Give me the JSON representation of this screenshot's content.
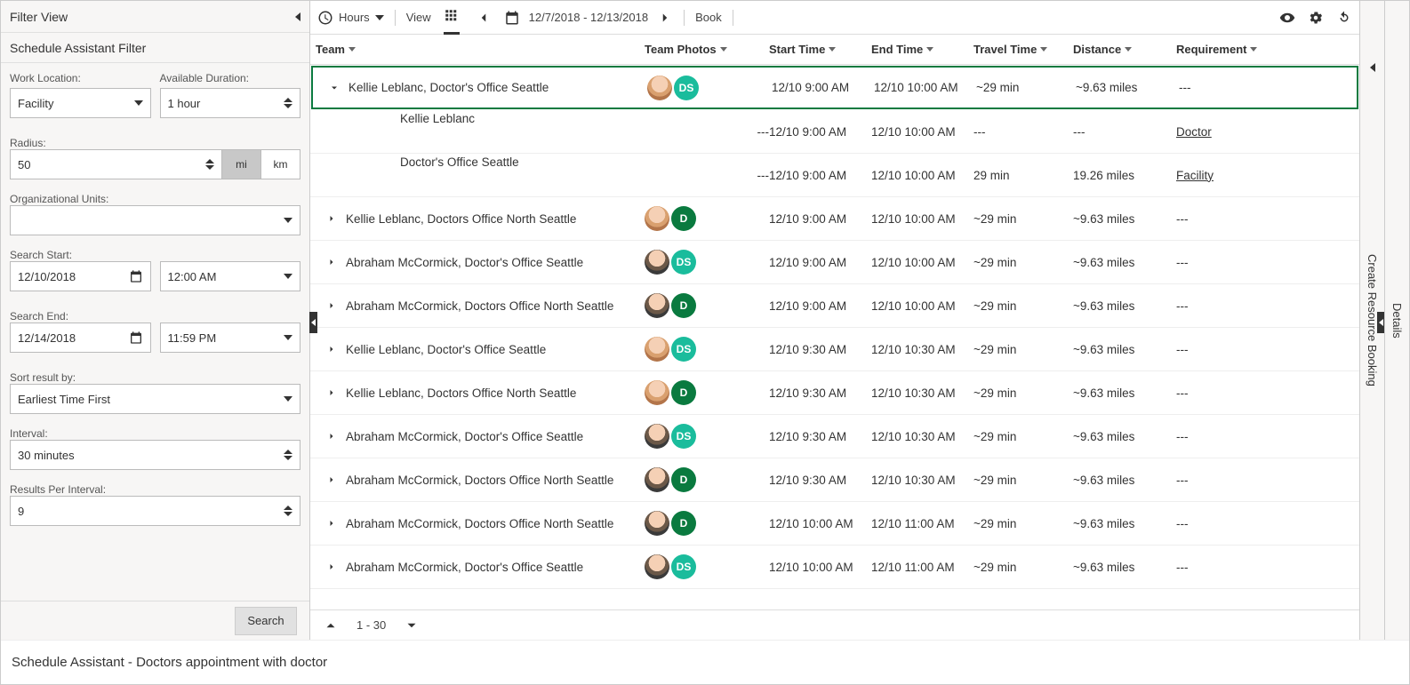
{
  "footer_title": "Schedule Assistant - Doctors appointment with doctor",
  "filter": {
    "panel_title": "Filter View",
    "sub_title": "Schedule Assistant Filter",
    "work_location_label": "Work Location:",
    "work_location_value": "Facility",
    "available_duration_label": "Available Duration:",
    "available_duration_value": "1 hour",
    "radius_label": "Radius:",
    "radius_value": "50",
    "unit_mi": "mi",
    "unit_km": "km",
    "org_units_label": "Organizational Units:",
    "org_units_value": "",
    "search_start_label": "Search Start:",
    "search_start_date": "12/10/2018",
    "search_start_time": "12:00 AM",
    "search_end_label": "Search End:",
    "search_end_date": "12/14/2018",
    "search_end_time": "11:59 PM",
    "sort_label": "Sort result by:",
    "sort_value": "Earliest Time First",
    "interval_label": "Interval:",
    "interval_value": "30 minutes",
    "results_per_label": "Results Per Interval:",
    "results_per_value": "9",
    "search_button": "Search"
  },
  "toolbar": {
    "hours": "Hours",
    "view": "View",
    "date_range": "12/7/2018 - 12/13/2018",
    "book": "Book"
  },
  "columns": {
    "team": "Team",
    "photos": "Team Photos",
    "start": "Start Time",
    "end": "End Time",
    "travel": "Travel Time",
    "distance": "Distance",
    "requirement": "Requirement"
  },
  "rows": [
    {
      "expanded": true,
      "selected": true,
      "team": "Kellie Leblanc, Doctor's Office Seattle",
      "photos": [
        "f",
        "DS"
      ],
      "start": "12/10 9:00 AM",
      "end": "12/10 10:00 AM",
      "travel": "~29 min",
      "dist": "~9.63 miles",
      "req": "---"
    },
    {
      "indent": true,
      "team": "Kellie Leblanc",
      "photos": [
        "f_big"
      ],
      "photo_text": "---",
      "start": "12/10 9:00 AM",
      "end": "12/10 10:00 AM",
      "travel": "---",
      "dist": "---",
      "req": "Doctor",
      "req_link": true
    },
    {
      "indent": true,
      "team": "Doctor's Office Seattle",
      "photos": [
        "g_big"
      ],
      "photo_text": "---",
      "start": "12/10 9:00 AM",
      "end": "12/10 10:00 AM",
      "travel": "29 min",
      "dist": "19.26 miles",
      "req": "Facility",
      "req_link": true
    },
    {
      "team": "Kellie Leblanc, Doctors Office North Seattle",
      "photos": [
        "f",
        "D"
      ],
      "start": "12/10 9:00 AM",
      "end": "12/10 10:00 AM",
      "travel": "~29 min",
      "dist": "~9.63 miles",
      "req": "---"
    },
    {
      "team": "Abraham McCormick, Doctor's Office Seattle",
      "photos": [
        "m",
        "DS"
      ],
      "start": "12/10 9:00 AM",
      "end": "12/10 10:00 AM",
      "travel": "~29 min",
      "dist": "~9.63 miles",
      "req": "---"
    },
    {
      "team": "Abraham McCormick, Doctors Office North Seattle",
      "photos": [
        "m",
        "D"
      ],
      "start": "12/10 9:00 AM",
      "end": "12/10 10:00 AM",
      "travel": "~29 min",
      "dist": "~9.63 miles",
      "req": "---"
    },
    {
      "team": "Kellie Leblanc, Doctor's Office Seattle",
      "photos": [
        "f",
        "DS"
      ],
      "start": "12/10 9:30 AM",
      "end": "12/10 10:30 AM",
      "travel": "~29 min",
      "dist": "~9.63 miles",
      "req": "---"
    },
    {
      "team": "Kellie Leblanc, Doctors Office North Seattle",
      "photos": [
        "f",
        "D"
      ],
      "start": "12/10 9:30 AM",
      "end": "12/10 10:30 AM",
      "travel": "~29 min",
      "dist": "~9.63 miles",
      "req": "---"
    },
    {
      "team": "Abraham McCormick, Doctor's Office Seattle",
      "photos": [
        "m",
        "DS"
      ],
      "start": "12/10 9:30 AM",
      "end": "12/10 10:30 AM",
      "travel": "~29 min",
      "dist": "~9.63 miles",
      "req": "---"
    },
    {
      "team": "Abraham McCormick, Doctors Office North Seattle",
      "photos": [
        "m",
        "D"
      ],
      "start": "12/10 9:30 AM",
      "end": "12/10 10:30 AM",
      "travel": "~29 min",
      "dist": "~9.63 miles",
      "req": "---"
    },
    {
      "team": "Abraham McCormick, Doctors Office North Seattle",
      "photos": [
        "m",
        "D"
      ],
      "start": "12/10 10:00 AM",
      "end": "12/10 11:00 AM",
      "travel": "~29 min",
      "dist": "~9.63 miles",
      "req": "---"
    },
    {
      "team": "Abraham McCormick, Doctor's Office Seattle",
      "photos": [
        "m",
        "DS"
      ],
      "start": "12/10 10:00 AM",
      "end": "12/10 11:00 AM",
      "travel": "~29 min",
      "dist": "~9.63 miles",
      "req": "---"
    }
  ],
  "pager": {
    "range": "1 - 30"
  },
  "right": {
    "create": "Create Resource Booking",
    "details": "Details"
  }
}
